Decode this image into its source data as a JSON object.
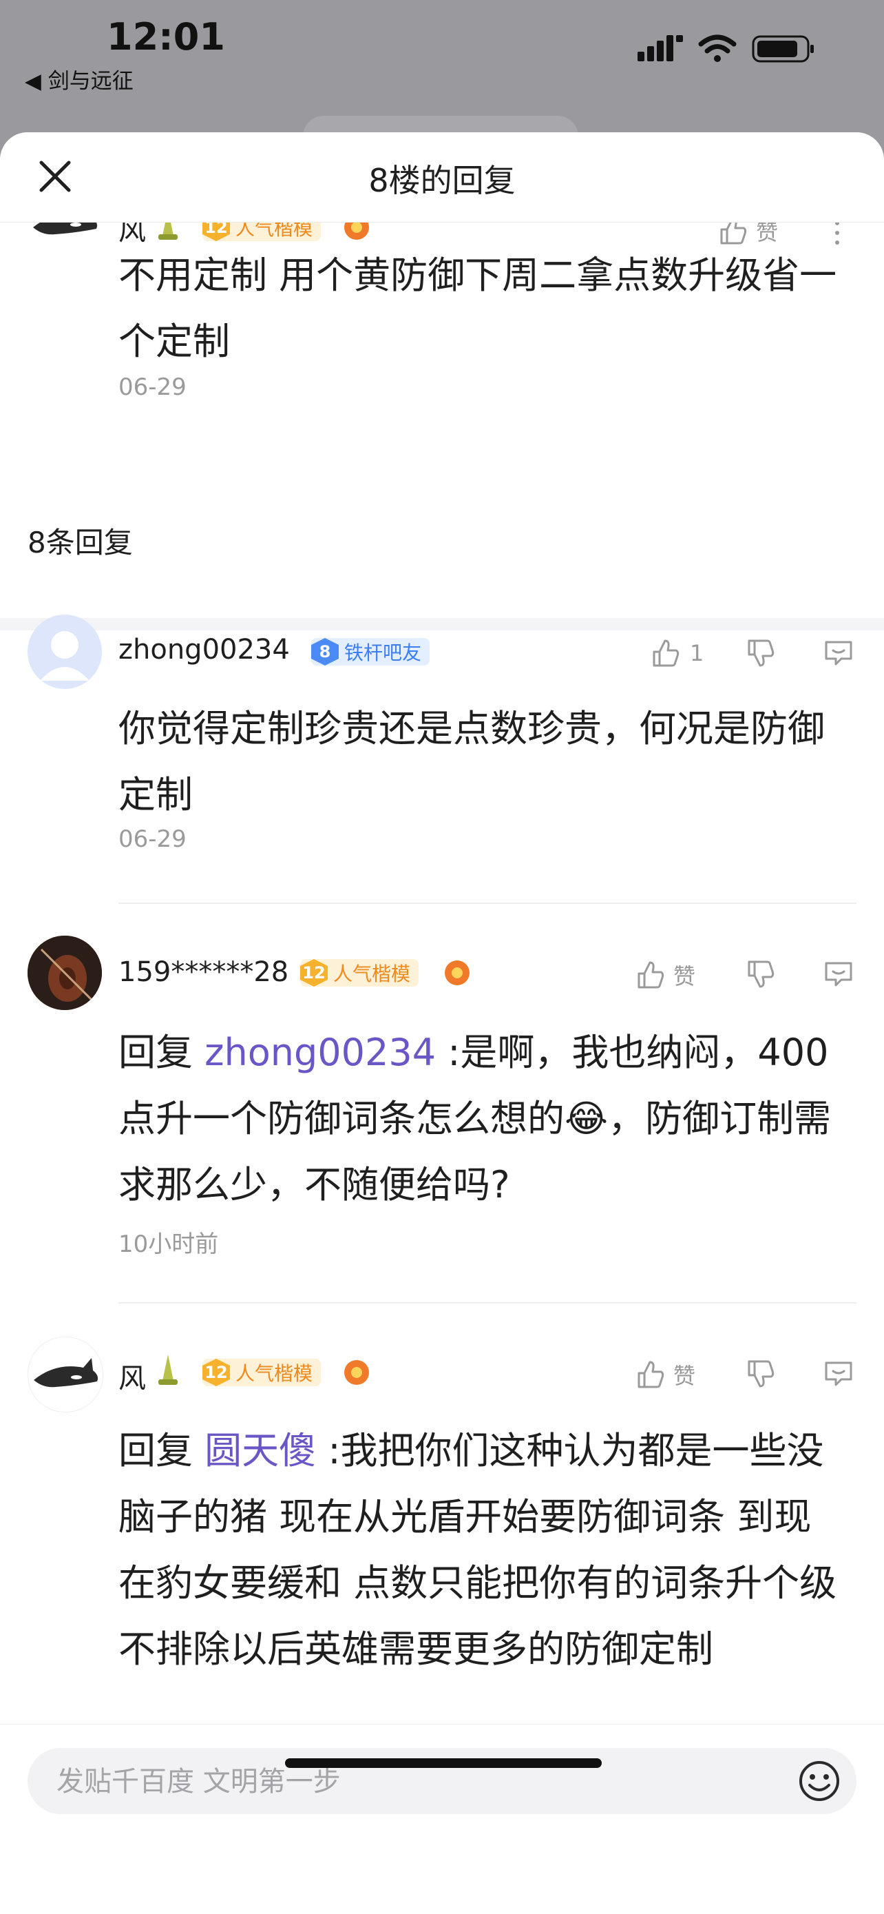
{
  "status_bar": {
    "time": "12:01",
    "back_app": "◀ 剑与远征"
  },
  "sheet": {
    "title": "8楼的回复"
  },
  "floor_post": {
    "user": "风",
    "badge_level": "12",
    "badge_text": "人气楷模",
    "like_label": "赞",
    "content": "不用定制 用个黄防御下周二拿点数升级省一个定制",
    "date": "06-29"
  },
  "reply_count": "8条回复",
  "replies": [
    {
      "user": "zhong00234",
      "badge_level": "8",
      "badge_text": "铁杆吧友",
      "like_label": "1",
      "content": "你觉得定制珍贵还是点数珍贵，何况是防御定制",
      "date": "06-29"
    },
    {
      "user": "159******28",
      "badge_level": "12",
      "badge_text": "人气楷模",
      "like_label": "赞",
      "reply_prefix": "回复 ",
      "mention": "zhong00234",
      "content": " :是啊，我也纳闷，400点升一个防御词条怎么想的😂，防御订制需求那么少，不随便给吗?",
      "date": "10小时前"
    },
    {
      "user": "风",
      "badge_level": "12",
      "badge_text": "人气楷模",
      "like_label": "赞",
      "reply_prefix": "回复 ",
      "mention": "圆天傻",
      "content": " :我把你们这种认为都是一些没脑子的猪 现在从光盾开始要防御词条 到现在豹女要缓和 点数只能把你有的词条升个级 不排除以后英雄需要更多的防御定制"
    }
  ],
  "input": {
    "placeholder": "发贴千百度 文明第一步"
  }
}
